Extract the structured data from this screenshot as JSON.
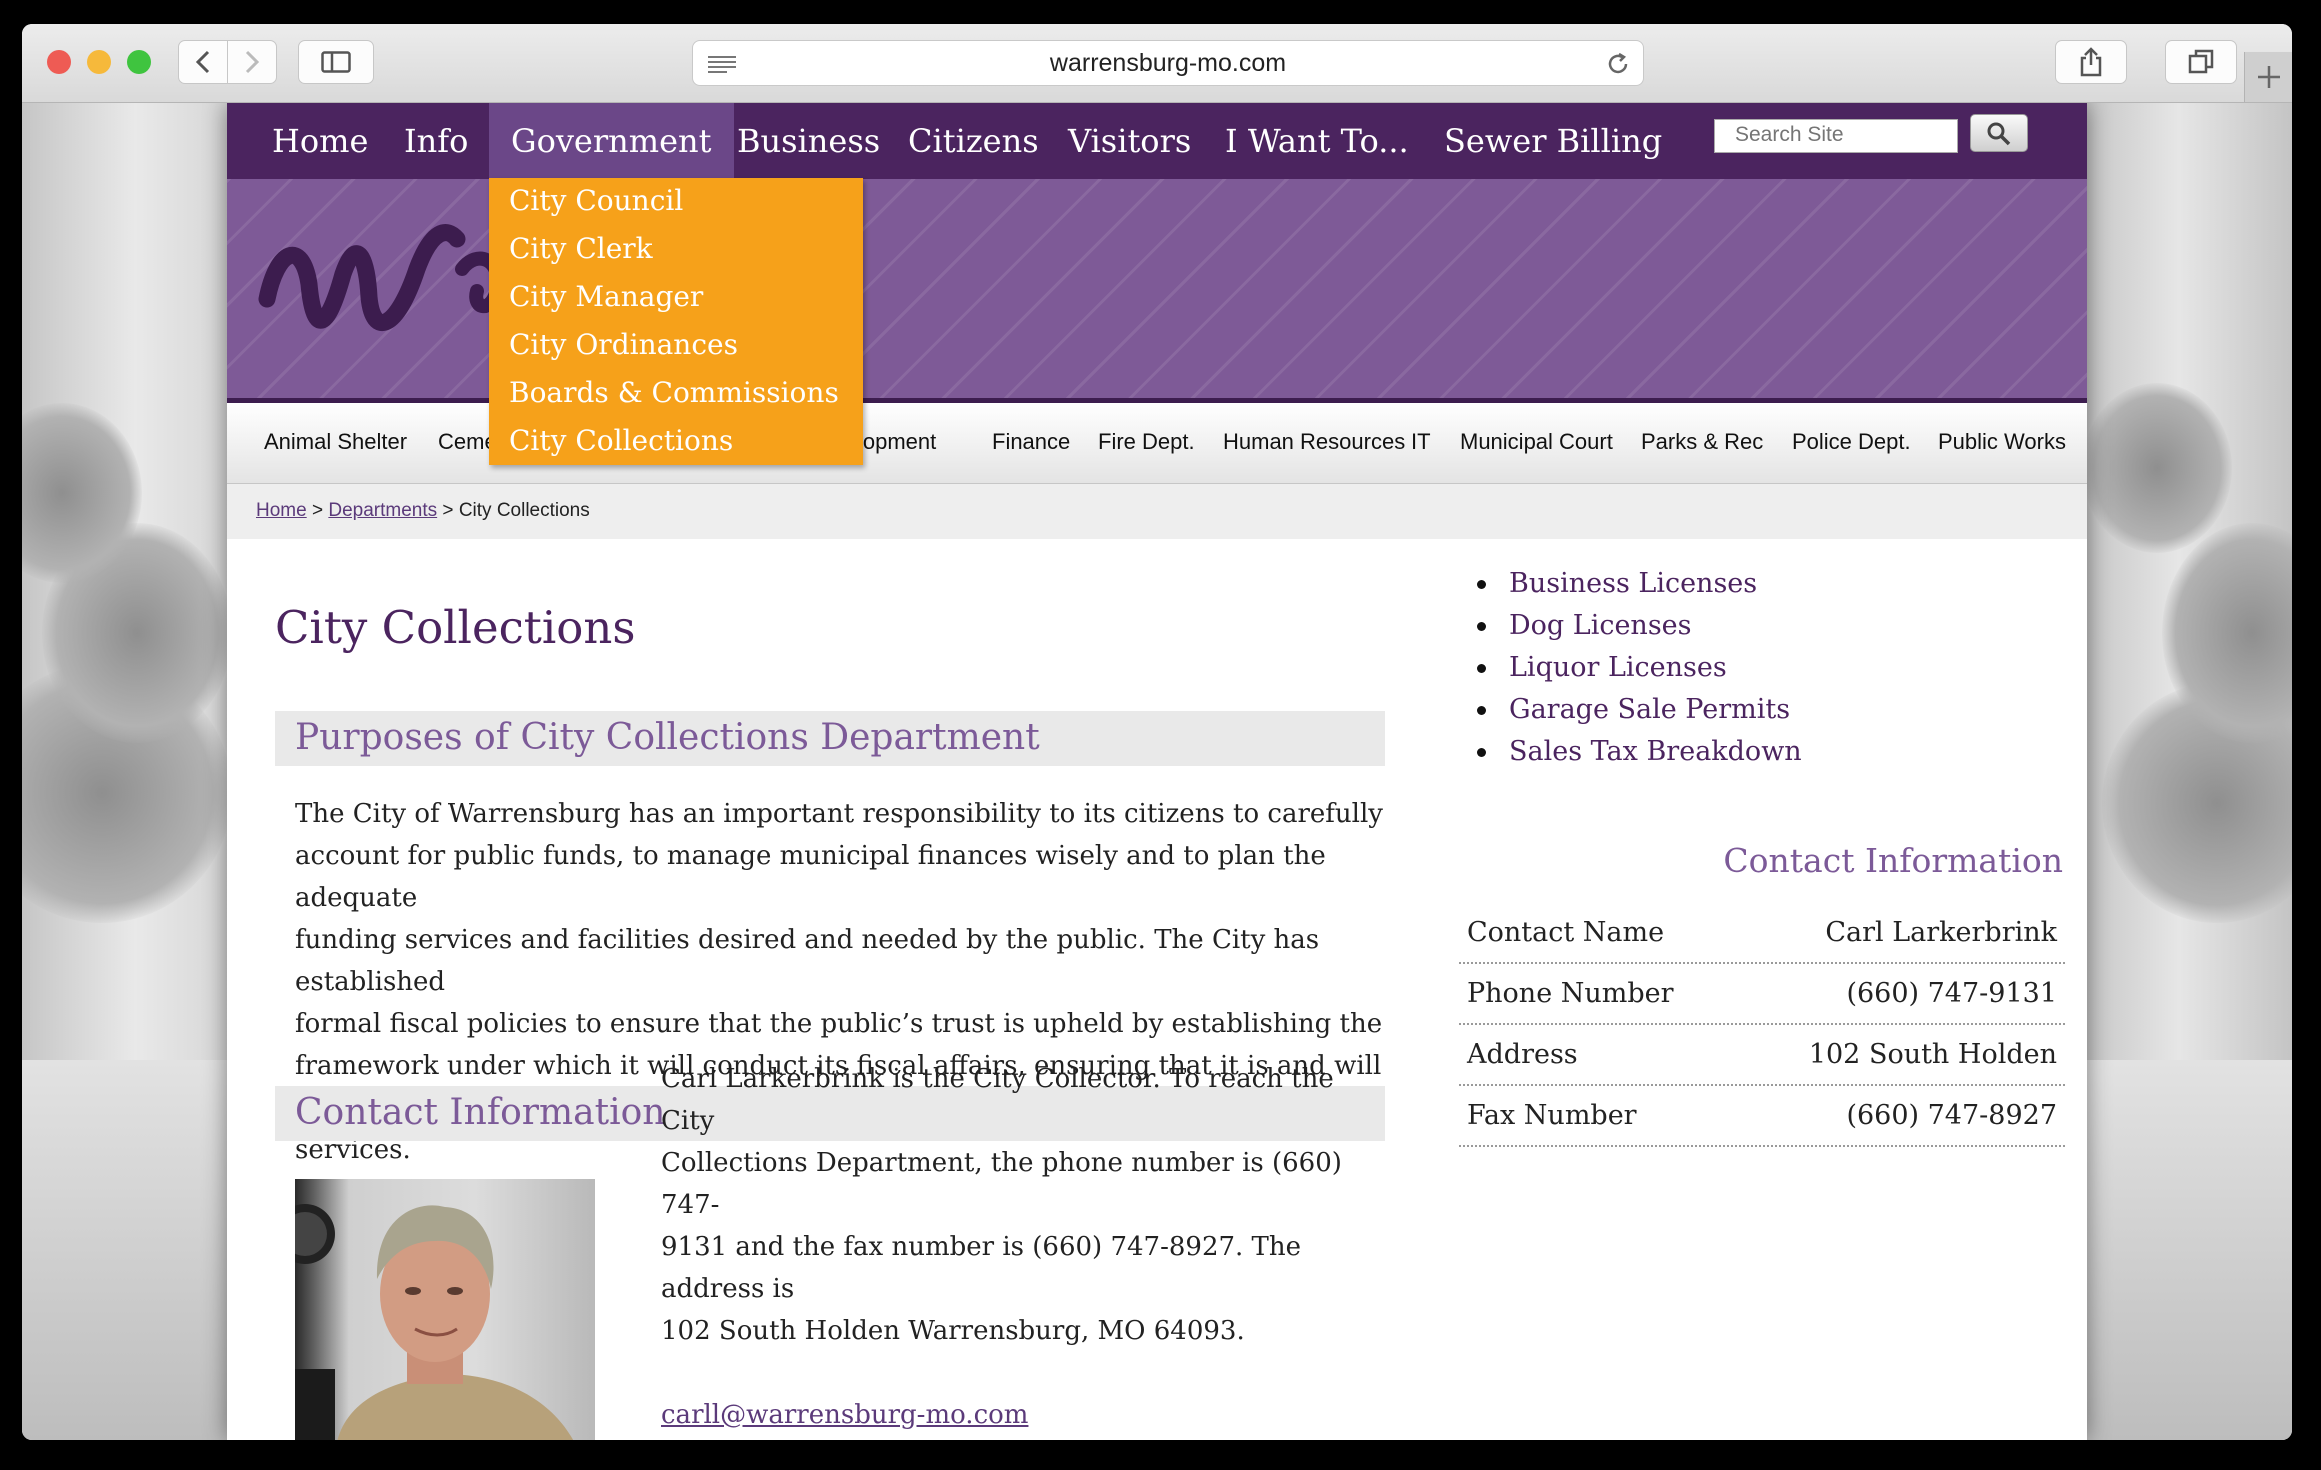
{
  "browser": {
    "url": "warrensburg-mo.com",
    "colors": {
      "close": "#ee5b54",
      "minimize": "#f6b93b",
      "zoom": "#3fc43f"
    }
  },
  "site": {
    "nav": [
      "Home",
      "Info",
      "Government",
      "Business",
      "Citizens",
      "Visitors",
      "I Want To...",
      "Sewer Billing"
    ],
    "active_nav": "Government",
    "search_placeholder": "Search Site",
    "dropdown": [
      "City Council",
      "City Clerk",
      "City Manager",
      "City Ordinances",
      "Boards & Commissions",
      "City Collections"
    ],
    "departments": [
      "Animal Shelter",
      "Ceme",
      "lopment",
      "Finance",
      "Fire Dept.",
      "Human Resources",
      "IT",
      "Municipal Court",
      "Parks & Rec",
      "Police Dept.",
      "Public Works"
    ],
    "breadcrumb": {
      "home": "Home",
      "sep1": ">",
      "departments": "Departments",
      "sep2": ">",
      "current": "City Collections"
    },
    "colors": {
      "nav_bg": "#4b245f",
      "banner": "#7e5a97",
      "dropdown": "#f6a11a",
      "heading": "#7c5a98"
    }
  },
  "main": {
    "title": "City Collections",
    "section1_title": "Purposes of City Collections Department",
    "section1_lines": [
      "The City of Warrensburg has an important responsibility to its citizens to carefully",
      "account for public funds, to manage municipal finances wisely and to plan the adequate",
      "funding services and facilities desired and needed by the public. The City has established",
      "formal fiscal policies to ensure that the public’s trust is upheld by establishing the",
      "framework under which it will conduct its fiscal affairs, ensuring that it is and will",
      "continue to be capable of funding and providing outstanding local government services."
    ],
    "section2_title": "Contact Information",
    "contact_lines": [
      "Carl Larkerbrink is the City Collector. To reach the City",
      "Collections Department, the phone number is (660) 747-",
      "9131 and the fax number is (660) 747-8927. The address is",
      "102 South Holden Warrensburg, MO 64093."
    ],
    "email": "carll@warrensburg-mo.com"
  },
  "sidebar": {
    "links": [
      "Business Licenses",
      "Dog Licenses",
      "Liquor Licenses",
      "Garage Sale Permits",
      "Sales Tax Breakdown"
    ],
    "contact_title": "Contact Information",
    "contact": [
      {
        "label": "Contact Name",
        "value": "Carl Larkerbrink"
      },
      {
        "label": "Phone Number",
        "value": "(660) 747-9131"
      },
      {
        "label": "Address",
        "value": "102 South Holden"
      },
      {
        "label": "Fax Number",
        "value": "(660) 747-8927"
      }
    ]
  }
}
